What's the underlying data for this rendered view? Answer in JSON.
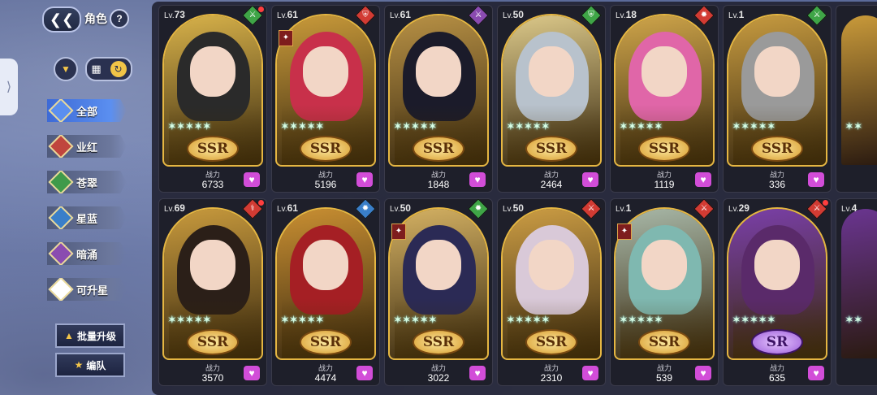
{
  "header": {
    "title": "角色",
    "help_label": "?",
    "back_icon": "back-arrow-icon"
  },
  "toolbar": {
    "filter_icon": "filter-icon",
    "grid_icon": "grid-icon",
    "swap_icon": "swap-icon"
  },
  "sidebar": {
    "items": [
      {
        "label": "全部",
        "active": true,
        "color": "#5b8ff0"
      },
      {
        "label": "业红",
        "active": false,
        "color": "#c0453e"
      },
      {
        "label": "苍翠",
        "active": false,
        "color": "#3f9a4a"
      },
      {
        "label": "星蓝",
        "active": false,
        "color": "#3a7fc9"
      },
      {
        "label": "暗涌",
        "active": false,
        "color": "#8a4bb0"
      },
      {
        "label": "可升星",
        "active": false,
        "color": "#ffffff"
      }
    ],
    "batch_upgrade": "批量升级",
    "team": "编队"
  },
  "power_label": "战力",
  "cards": [
    {
      "lv": "73",
      "grade": "SSR",
      "power": "6733",
      "elem": "#3fa547",
      "elem_icon": "sword-icon",
      "hair": "#2a2a2a",
      "bg": "#d8b24a",
      "dot": true
    },
    {
      "lv": "61",
      "grade": "SSR",
      "power": "5196",
      "elem": "#d23b33",
      "elem_icon": "shield-icon",
      "hair": "#c8304a",
      "bg": "#c99a3a",
      "rank": true
    },
    {
      "lv": "61",
      "grade": "SSR",
      "power": "1848",
      "elem": "#8a4bb0",
      "elem_icon": "sword-icon",
      "hair": "#1b1b2a",
      "bg": "#b89145"
    },
    {
      "lv": "50",
      "grade": "SSR",
      "power": "2464",
      "elem": "#3fa547",
      "elem_icon": "shield-icon",
      "hair": "#b8c2cc",
      "bg": "#dcc98a"
    },
    {
      "lv": "18",
      "grade": "SSR",
      "power": "1119",
      "elem": "#d23b33",
      "elem_icon": "flame-icon",
      "hair": "#e066a8",
      "bg": "#cfa54a"
    },
    {
      "lv": "1",
      "grade": "SSR",
      "power": "336",
      "elem": "#3fa547",
      "elem_icon": "sword-icon",
      "hair": "#9a9a9a",
      "bg": "#c79b40"
    },
    {
      "lv": "69",
      "grade": "SSR",
      "power": "3570",
      "elem": "#d23b33",
      "elem_icon": "staff-icon",
      "hair": "#2b1f18",
      "bg": "#c89a3d",
      "dot": true
    },
    {
      "lv": "61",
      "grade": "SSR",
      "power": "4474",
      "elem": "#3a7fc9",
      "elem_icon": "flame-icon",
      "hair": "#a51f24",
      "bg": "#c98f32"
    },
    {
      "lv": "50",
      "grade": "SSR",
      "power": "3022",
      "elem": "#3fa547",
      "elem_icon": "flame-icon",
      "hair": "#2b2a55",
      "bg": "#d4b163",
      "rank": true
    },
    {
      "lv": "50",
      "grade": "SSR",
      "power": "2310",
      "elem": "#d23b33",
      "elem_icon": "sword-icon",
      "hair": "#d9c9d8",
      "bg": "#cc9d44"
    },
    {
      "lv": "1",
      "grade": "SSR",
      "power": "539",
      "elem": "#d23b33",
      "elem_icon": "sword-icon",
      "hair": "#7fb8b0",
      "bg": "#a8b8a8",
      "rank": true
    },
    {
      "lv": "29",
      "grade": "SR",
      "power": "635",
      "elem": "#d23b33",
      "elem_icon": "sword-icon",
      "hair": "#5a2a6a",
      "bg": "#7a3fa8",
      "dot": true
    }
  ],
  "partial_cards": [
    {
      "lv": "4"
    }
  ]
}
